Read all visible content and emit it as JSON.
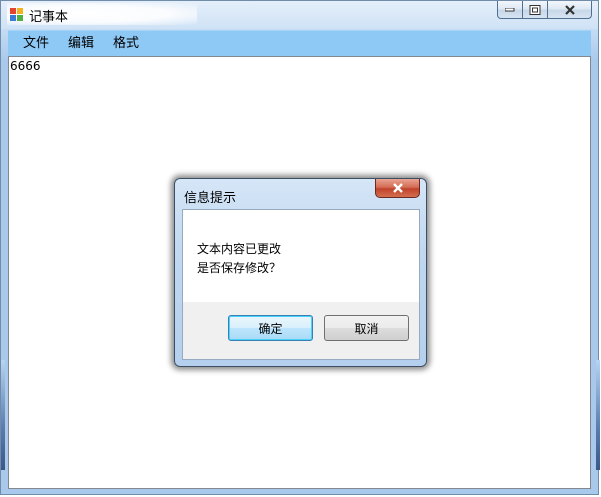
{
  "window": {
    "title": "记事本",
    "icon": "app-icon",
    "caption_buttons": [
      "minimize-icon",
      "restore-icon",
      "close-icon"
    ]
  },
  "menu": {
    "items": [
      {
        "label": "文件"
      },
      {
        "label": "编辑"
      },
      {
        "label": "格式"
      }
    ]
  },
  "editor": {
    "content": "6666"
  },
  "dialog": {
    "title": "信息提示",
    "message_line1": "文本内容已更改",
    "message_line2": "是否保存修改？",
    "ok_label": "确定",
    "cancel_label": "取消"
  },
  "colors": {
    "menubar": "#8ec8f5",
    "close_red": "#c0432a",
    "default_button_border": "#3c7fb1"
  }
}
